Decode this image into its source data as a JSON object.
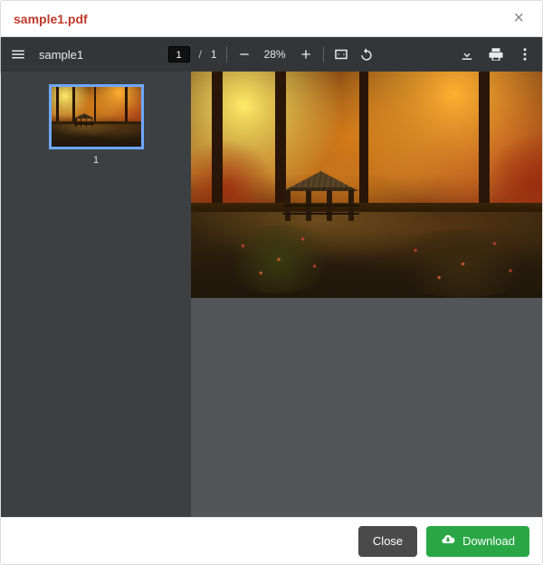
{
  "modal": {
    "title": "sample1.pdf",
    "close_icon_glyph": "×"
  },
  "toolbar": {
    "doc_title": "sample1",
    "page_current": "1",
    "page_total": "1",
    "zoom_label": "28%"
  },
  "sidebar": {
    "thumb_label": "1"
  },
  "footer": {
    "close_label": "Close",
    "download_label": "Download"
  }
}
